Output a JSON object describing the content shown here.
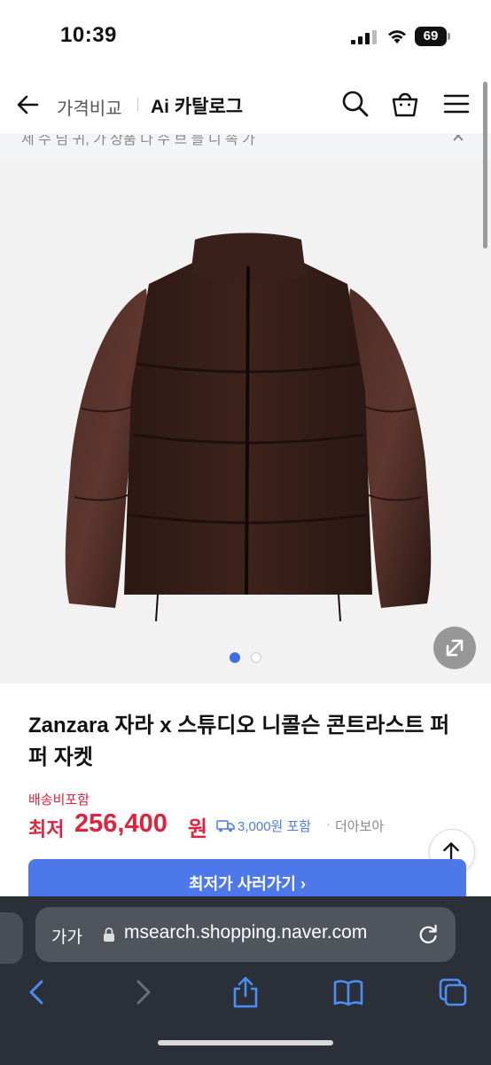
{
  "status_bar": {
    "time": "10:39",
    "battery": "69"
  },
  "header": {
    "back_icon": "arrow-left-icon",
    "link_label": "가격비교",
    "title": "Ai 카탈로그",
    "search_icon": "search-icon",
    "bag_icon": "shopping-bag-icon",
    "menu_icon": "hamburger-menu-icon"
  },
  "notice": {
    "text": "세 수 님 귀, 가 상품 다 수 브 들 니 속 가",
    "close_icon": "close-icon"
  },
  "gallery": {
    "image_alt": "dark brown puffer jacket",
    "current_slide": 1,
    "total_slides": 2,
    "expand_icon": "expand-icon"
  },
  "product": {
    "title": "Zanzara 자라 x 스튜디오 니콜슨 콘트라스트 퍼퍼 자켓",
    "shipping_label": "배송비포함",
    "price_prefix": "최저",
    "price_value": "256,400",
    "price_unit": "원",
    "shipping_fee": "3,000원 포함",
    "separator": "·",
    "more_link": "더아보아",
    "buy_button": "최저가 사러가기 ›"
  },
  "scroll_top": {
    "icon": "arrow-up-icon"
  },
  "safari": {
    "aa_label": "가가",
    "url": "msearch.shopping.naver.com",
    "lock_icon": "lock-icon",
    "reload_icon": "reload-icon",
    "toolbar": [
      "chevron-left-icon",
      "chevron-right-icon",
      "share-icon",
      "book-icon",
      "tabs-icon"
    ]
  },
  "colors": {
    "accent": "#4d78ea",
    "price_red": "#e0233c",
    "safari_bg": "#2b3038"
  }
}
